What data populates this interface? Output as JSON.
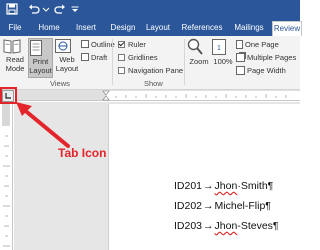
{
  "quick_access": {
    "save_icon": "save-icon",
    "undo_icon": "undo-icon",
    "redo_icon": "redo-icon",
    "customize_icon": "customize-qat-icon"
  },
  "tabs": [
    {
      "label": "File"
    },
    {
      "label": "Home"
    },
    {
      "label": "Insert"
    },
    {
      "label": "Design"
    },
    {
      "label": "Layout"
    },
    {
      "label": "References"
    },
    {
      "label": "Mailings"
    },
    {
      "label": "Review"
    }
  ],
  "ribbon": {
    "views": {
      "read_mode": [
        "Read",
        "Mode"
      ],
      "print_layout": [
        "Print",
        "Layout"
      ],
      "web_layout": [
        "Web",
        "Layout"
      ],
      "outline": "Outline",
      "draft": "Draft",
      "group_label": "Views"
    },
    "show": {
      "ruler": "Ruler",
      "gridlines": "Gridlines",
      "navigation_pane": "Navigation Pane",
      "ruler_checked": true,
      "gridlines_checked": false,
      "navigation_pane_checked": false,
      "group_label": "Show"
    },
    "zoom": {
      "zoom": "Zoom",
      "hundred": "100%",
      "one_page": "One Page",
      "multiple_pages": "Multiple Pages",
      "page_width": "Page Width"
    }
  },
  "document": {
    "lines": [
      {
        "id": "ID201",
        "arrow": "→",
        "first": "Jhon",
        "dot": "·",
        "last": "Smith",
        "mark": "¶"
      },
      {
        "id": "ID202",
        "arrow": "→",
        "first": "Michel",
        "dot": "-",
        "last": "Flip",
        "mark": "¶"
      },
      {
        "id": "ID203",
        "arrow": "→",
        "first": "Jhon",
        "dot": "-",
        "last": "Steves",
        "mark": "¶"
      }
    ]
  },
  "annotation": {
    "label": "Tab Icon",
    "color": "#e3242b"
  },
  "colors": {
    "accent": "#2b579a"
  }
}
